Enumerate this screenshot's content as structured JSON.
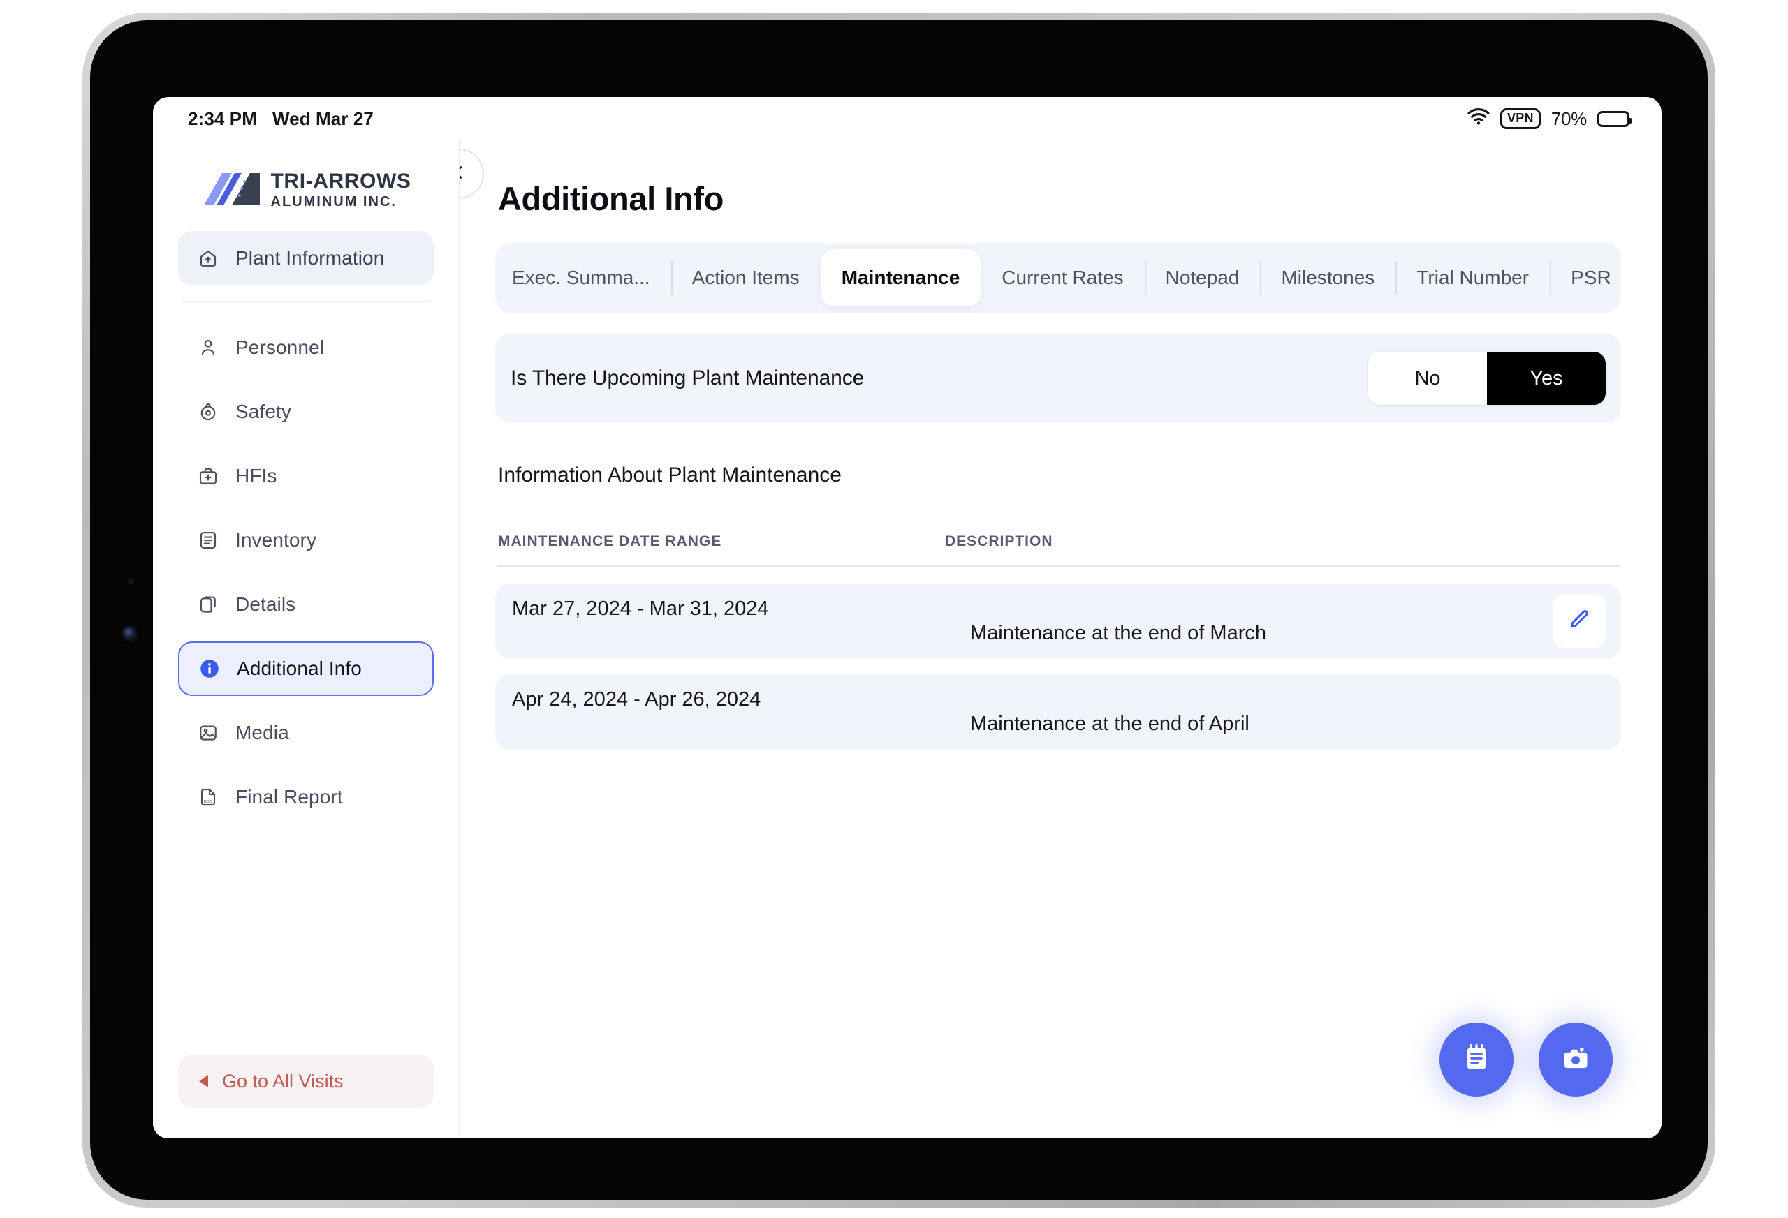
{
  "status_bar": {
    "time": "2:34 PM",
    "date": "Wed Mar 27",
    "vpn_label": "VPN",
    "battery_percent": "70%",
    "wifi_icon": "wifi-icon",
    "battery_icon": "battery-icon"
  },
  "sidebar": {
    "brand": {
      "title": "TRI-ARROWS",
      "subtitle": "ALUMINUM INC.",
      "mark_icon": "tri-arrows-logo-icon"
    },
    "top_item": {
      "label": "Plant Information",
      "icon": "plant-upload-icon"
    },
    "items": [
      {
        "label": "Personnel",
        "icon": "person-icon",
        "selected": false
      },
      {
        "label": "Safety",
        "icon": "safety-lock-icon",
        "selected": false
      },
      {
        "label": "HFIs",
        "icon": "first-aid-kit-icon",
        "selected": false
      },
      {
        "label": "Inventory",
        "icon": "list-document-icon",
        "selected": false
      },
      {
        "label": "Details",
        "icon": "copy-pages-icon",
        "selected": false
      },
      {
        "label": "Additional Info",
        "icon": "info-circle-icon",
        "selected": true
      },
      {
        "label": "Media",
        "icon": "image-icon",
        "selected": false
      },
      {
        "label": "Final Report",
        "icon": "doc-file-icon",
        "selected": false
      }
    ],
    "all_visits": {
      "label": "Go to All Visits",
      "icon": "back-arrow-icon",
      "color": "#c35a56"
    }
  },
  "main": {
    "back_button_icon": "chevron-left-icon",
    "page_title": "Additional Info",
    "tabs": [
      {
        "label": "Exec. Summa...",
        "active": false
      },
      {
        "label": "Action Items",
        "active": false
      },
      {
        "label": "Maintenance",
        "active": true
      },
      {
        "label": "Current Rates",
        "active": false
      },
      {
        "label": "Notepad",
        "active": false
      },
      {
        "label": "Milestones",
        "active": false
      },
      {
        "label": "Trial Number",
        "active": false
      },
      {
        "label": "PSR",
        "active": false
      }
    ],
    "maintenance_toggle": {
      "question": "Is There Upcoming Plant Maintenance",
      "option_no": "No",
      "option_yes": "Yes",
      "selected": "Yes"
    },
    "section_subtitle": "Information About Plant Maintenance",
    "table": {
      "headers": {
        "date_range": "MAINTENANCE DATE RANGE",
        "description": "DESCRIPTION"
      },
      "rows": [
        {
          "date_range": "Mar 27, 2024 - Mar 31, 2024",
          "description": "Maintenance at the end of March",
          "has_edit": true,
          "edit_icon": "pencil-edit-icon"
        },
        {
          "date_range": "Apr 24, 2024 - Apr 26, 2024",
          "description": "Maintenance at the end of April",
          "has_edit": false,
          "edit_icon": ""
        }
      ]
    },
    "fabs": [
      {
        "icon": "notes-icon",
        "name": "add-note-fab"
      },
      {
        "icon": "camera-icon",
        "name": "camera-fab"
      }
    ],
    "accent_color": "#5468f0"
  }
}
